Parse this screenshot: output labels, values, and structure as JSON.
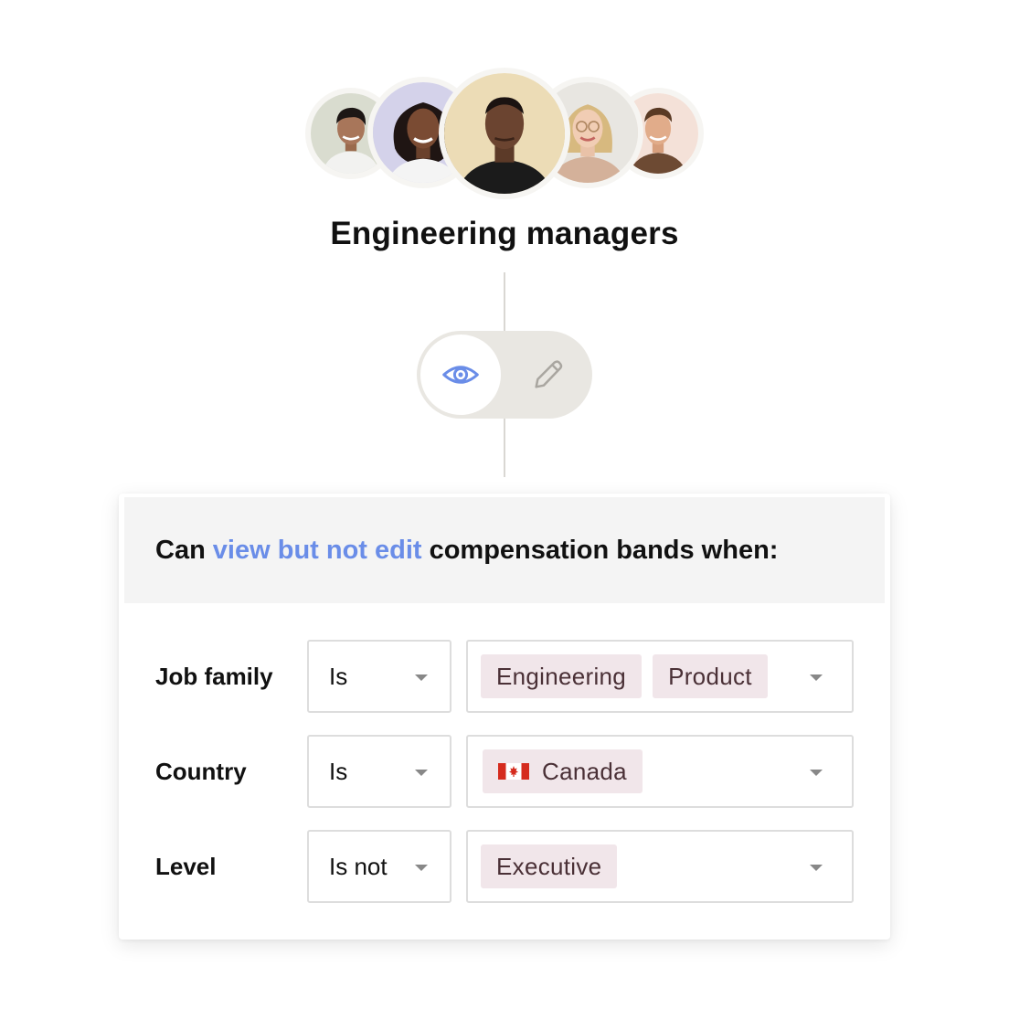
{
  "group": {
    "title": "Engineering managers",
    "avatars": [
      "avatar-1",
      "avatar-2",
      "avatar-3",
      "avatar-4",
      "avatar-5"
    ]
  },
  "toggle": {
    "options": [
      {
        "name": "view",
        "icon": "eye-icon",
        "selected": true
      },
      {
        "name": "edit",
        "icon": "pencil-icon",
        "selected": false
      }
    ],
    "accent_color": "#6a8de8"
  },
  "rule": {
    "prefix": "Can",
    "permission": "view but not edit",
    "suffix": "compensation bands when:"
  },
  "conditions": [
    {
      "label": "Job family",
      "operator": "Is",
      "values": [
        "Engineering",
        "Product"
      ]
    },
    {
      "label": "Country",
      "operator": "Is",
      "values": [
        "Canada"
      ],
      "flag_icon": "canada-flag-icon"
    },
    {
      "label": "Level",
      "operator": "Is not",
      "values": [
        "Executive"
      ]
    }
  ],
  "colors": {
    "chip_background": "#f1e6ea",
    "accent": "#6a8de8",
    "toggle_track": "#e9e7e2"
  }
}
